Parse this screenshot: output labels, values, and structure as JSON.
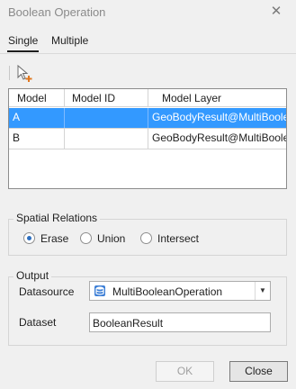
{
  "window": {
    "title": "Boolean Operation"
  },
  "tabs": [
    {
      "label": "Single",
      "active": true
    },
    {
      "label": "Multiple",
      "active": false
    }
  ],
  "toolbar": {
    "icon": "select-add-icon"
  },
  "table": {
    "columns": [
      "Model",
      "Model ID",
      "Model Layer"
    ],
    "rows": [
      {
        "model": "A",
        "model_id": "",
        "model_layer": "GeoBodyResult@MultiBooleanOperation",
        "selected": true
      },
      {
        "model": "B",
        "model_id": "",
        "model_layer": "GeoBodyResult@MultiBooleanOperation",
        "selected": false
      }
    ]
  },
  "spatial": {
    "legend": "Spatial Relations",
    "options": [
      "Erase",
      "Union",
      "Intersect"
    ],
    "selected": "Erase"
  },
  "output": {
    "legend": "Output",
    "datasource_label": "Datasource",
    "datasource_value": "MultiBooleanOperation",
    "dataset_label": "Dataset",
    "dataset_value": "BooleanResult"
  },
  "buttons": {
    "ok": "OK",
    "close": "Close"
  },
  "colors": {
    "selection": "#3399ff",
    "radio_dot": "#2d6fc0"
  }
}
